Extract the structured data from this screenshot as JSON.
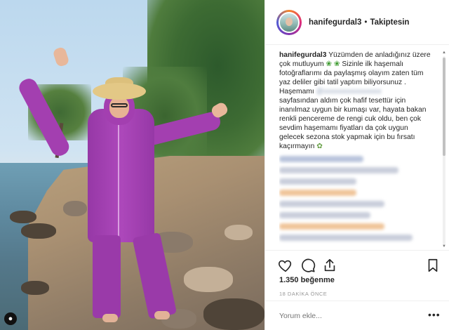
{
  "post": {
    "username": "hanifegurdal3",
    "separator": "•",
    "follow_status": "Takiptesin",
    "likes": "1.350 beğenme",
    "time": "18 DAKİKA ÖNCE",
    "comment_placeholder": "Yorum ekle...",
    "more_label": "•••"
  },
  "caption": {
    "username": "hanifegurdal3",
    "line1": " Yüzümden de anladığınız üzere çok mutluyum ",
    "line2": " Sizinle ilk haşemalı fotoğraflarımı da paylaşmış olayım zaten tüm yaz deliler gibi tatil yaptım biliyorsunuz .",
    "line3_prefix": "Haşemamı",
    "blurred_handle": "@xxxxxxxxxxxxxxxx",
    "line4": "sayfasından aldım çok hafif tesettür için inanılmaz uygun bir kumaşı var, hayata bakan renkli pencereme de rengi cuk oldu, ben çok sevdim haşemamı fiyatları da çok uygun gelecek sezona stok yapmak için bu fırsatı kaçırmayın "
  },
  "icons": {
    "leaf": "leaf-emoji",
    "flower": "flower-emoji",
    "heart": "heart-icon",
    "comment": "comment-icon",
    "share": "share-icon",
    "save": "bookmark-icon",
    "corner": "user-tag-icon"
  },
  "colors": {
    "accent_purple": "#a33fb0",
    "text": "#262626",
    "muted": "#999999",
    "border": "#efefef"
  }
}
